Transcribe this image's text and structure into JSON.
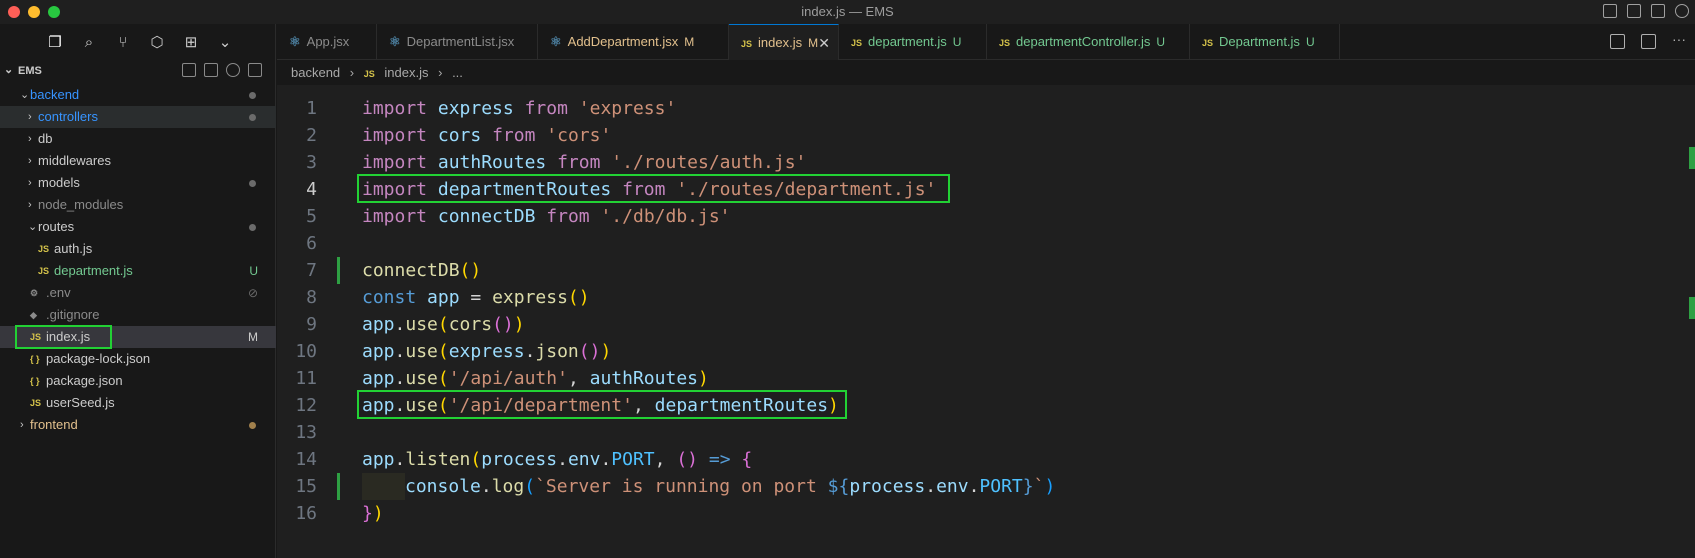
{
  "window": {
    "title": "index.js — EMS"
  },
  "explorer": {
    "root_label": "EMS",
    "tree": [
      {
        "label": "backend",
        "type": "folder",
        "depth": 0,
        "expanded": true,
        "dot": true,
        "color": "#3794ff"
      },
      {
        "label": "controllers",
        "type": "folder",
        "depth": 1,
        "expanded": false,
        "dot": true,
        "color": "#3794ff"
      },
      {
        "label": "db",
        "type": "folder",
        "depth": 1,
        "expanded": false
      },
      {
        "label": "middlewares",
        "type": "folder",
        "depth": 1,
        "expanded": false
      },
      {
        "label": "models",
        "type": "folder",
        "depth": 1,
        "expanded": false,
        "dot": true
      },
      {
        "label": "node_modules",
        "type": "folder",
        "depth": 1,
        "expanded": false,
        "dim": true
      },
      {
        "label": "routes",
        "type": "folder",
        "depth": 1,
        "expanded": true,
        "dot": true
      },
      {
        "label": "auth.js",
        "type": "js",
        "depth": 2
      },
      {
        "label": "department.js",
        "type": "js",
        "depth": 2,
        "badge": "U",
        "color": "#73c991"
      },
      {
        "label": ".env",
        "type": "env",
        "depth": 1,
        "dim": true,
        "badge": "⊘"
      },
      {
        "label": ".gitignore",
        "type": "git",
        "depth": 1,
        "dim": true
      },
      {
        "label": "index.js",
        "type": "js",
        "depth": 1,
        "badge": "M",
        "selected": true
      },
      {
        "label": "package-lock.json",
        "type": "json",
        "depth": 1
      },
      {
        "label": "package.json",
        "type": "json",
        "depth": 1
      },
      {
        "label": "userSeed.js",
        "type": "js",
        "depth": 1
      },
      {
        "label": "frontend",
        "type": "folder",
        "depth": 0,
        "expanded": false,
        "dot": true,
        "dotColor": "#a1804c",
        "color": "#e2c08d"
      }
    ]
  },
  "tabs": [
    {
      "label": "App.jsx",
      "icon": "react-icon",
      "status": "",
      "color": "#8b8b8b"
    },
    {
      "label": "DepartmentList.jsx",
      "icon": "react-icon",
      "status": "",
      "color": "#8b8b8b"
    },
    {
      "label": "AddDepartment.jsx",
      "icon": "react-icon",
      "status": "M",
      "color": "#e2c08d"
    },
    {
      "label": "index.js",
      "icon": "js-icon",
      "status": "M",
      "color": "#e2c08d",
      "active": true
    },
    {
      "label": "department.js",
      "icon": "js-icon",
      "status": "U",
      "color": "#73c991"
    },
    {
      "label": "departmentController.js",
      "icon": "js-icon",
      "status": "U",
      "color": "#73c991"
    },
    {
      "label": "Department.js",
      "icon": "js-icon",
      "status": "U",
      "color": "#73c991"
    }
  ],
  "breadcrumb": {
    "folder": "backend",
    "file": "index.js",
    "more": "..."
  },
  "editor": {
    "current_line": 4,
    "lines": [
      [
        [
          "kw2",
          "import"
        ],
        [
          "plain",
          " "
        ],
        [
          "id",
          "express"
        ],
        [
          "plain",
          " "
        ],
        [
          "kw2",
          "from"
        ],
        [
          "plain",
          " "
        ],
        [
          "str",
          "'express'"
        ]
      ],
      [
        [
          "kw2",
          "import"
        ],
        [
          "plain",
          " "
        ],
        [
          "id",
          "cors"
        ],
        [
          "plain",
          " "
        ],
        [
          "kw2",
          "from"
        ],
        [
          "plain",
          " "
        ],
        [
          "str",
          "'cors'"
        ]
      ],
      [
        [
          "kw2",
          "import"
        ],
        [
          "plain",
          " "
        ],
        [
          "id",
          "authRoutes"
        ],
        [
          "plain",
          " "
        ],
        [
          "kw2",
          "from"
        ],
        [
          "plain",
          " "
        ],
        [
          "str",
          "'./routes/auth.js'"
        ]
      ],
      [
        [
          "kw2",
          "import"
        ],
        [
          "plain",
          " "
        ],
        [
          "id",
          "departmentRoutes"
        ],
        [
          "plain",
          " "
        ],
        [
          "kw2",
          "from"
        ],
        [
          "plain",
          " "
        ],
        [
          "str",
          "'./routes/department.js'"
        ]
      ],
      [
        [
          "kw2",
          "import"
        ],
        [
          "plain",
          " "
        ],
        [
          "id",
          "connectDB"
        ],
        [
          "plain",
          " "
        ],
        [
          "kw2",
          "from"
        ],
        [
          "plain",
          " "
        ],
        [
          "str",
          "'./db/db.js'"
        ]
      ],
      [],
      [
        [
          "fn",
          "connectDB"
        ],
        [
          "br1",
          "()"
        ]
      ],
      [
        [
          "arrow",
          "const"
        ],
        [
          "plain",
          " "
        ],
        [
          "id",
          "app"
        ],
        [
          "plain",
          " = "
        ],
        [
          "fn",
          "express"
        ],
        [
          "br1",
          "()"
        ]
      ],
      [
        [
          "id",
          "app"
        ],
        [
          "plain",
          "."
        ],
        [
          "fn",
          "use"
        ],
        [
          "br1",
          "("
        ],
        [
          "fn",
          "cors"
        ],
        [
          "br2",
          "()"
        ],
        [
          "br1",
          ")"
        ]
      ],
      [
        [
          "id",
          "app"
        ],
        [
          "plain",
          "."
        ],
        [
          "fn",
          "use"
        ],
        [
          "br1",
          "("
        ],
        [
          "id",
          "express"
        ],
        [
          "plain",
          "."
        ],
        [
          "fn",
          "json"
        ],
        [
          "br2",
          "()"
        ],
        [
          "br1",
          ")"
        ]
      ],
      [
        [
          "id",
          "app"
        ],
        [
          "plain",
          "."
        ],
        [
          "fn",
          "use"
        ],
        [
          "br1",
          "("
        ],
        [
          "str",
          "'/api/auth'"
        ],
        [
          "plain",
          ", "
        ],
        [
          "id",
          "authRoutes"
        ],
        [
          "br1",
          ")"
        ]
      ],
      [
        [
          "id",
          "app"
        ],
        [
          "plain",
          "."
        ],
        [
          "fn",
          "use"
        ],
        [
          "br1",
          "("
        ],
        [
          "str",
          "'/api/department'"
        ],
        [
          "plain",
          ", "
        ],
        [
          "id",
          "departmentRoutes"
        ],
        [
          "br1",
          ")"
        ]
      ],
      [],
      [
        [
          "id",
          "app"
        ],
        [
          "plain",
          "."
        ],
        [
          "fn",
          "listen"
        ],
        [
          "br1",
          "("
        ],
        [
          "id",
          "process"
        ],
        [
          "plain",
          "."
        ],
        [
          "id",
          "env"
        ],
        [
          "plain",
          "."
        ],
        [
          "cst",
          "PORT"
        ],
        [
          "plain",
          ", "
        ],
        [
          "br2",
          "()"
        ],
        [
          "plain",
          " "
        ],
        [
          "arrow",
          "=>"
        ],
        [
          "plain",
          " "
        ],
        [
          "br2",
          "{"
        ]
      ],
      [
        [
          "indent",
          ""
        ],
        [
          "id",
          "console"
        ],
        [
          "plain",
          "."
        ],
        [
          "fn",
          "log"
        ],
        [
          "br3",
          "("
        ],
        [
          "str",
          "`Server is running on port "
        ],
        [
          "arrow",
          "${"
        ],
        [
          "id",
          "process"
        ],
        [
          "plain",
          "."
        ],
        [
          "id",
          "env"
        ],
        [
          "plain",
          "."
        ],
        [
          "cst",
          "PORT"
        ],
        [
          "arrow",
          "}"
        ],
        [
          "str",
          "`"
        ],
        [
          "br3",
          ")"
        ]
      ],
      [
        [
          "br2",
          "}"
        ],
        [
          "br1",
          ")"
        ]
      ]
    ]
  }
}
